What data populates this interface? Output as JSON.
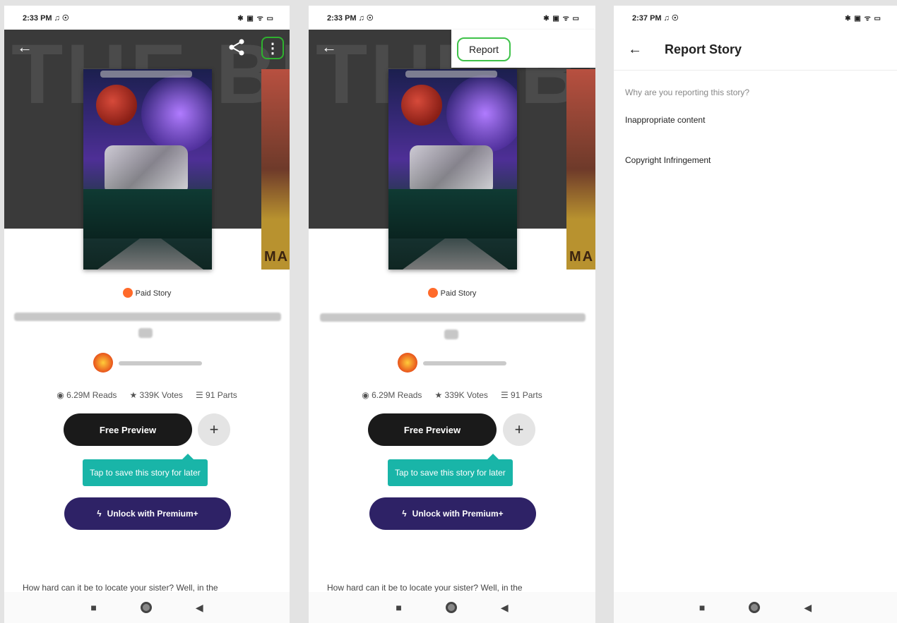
{
  "panel1": {
    "status": {
      "time": "2:33 PM ♫ ☉",
      "icons": "✱ ▣ ᯤ ▭"
    },
    "hero_text": "THE BR AH",
    "paid_label": "Paid Story",
    "stats": {
      "reads": "6.29M Reads",
      "votes": "339K Votes",
      "parts": "91 Parts"
    },
    "preview_label": "Free Preview",
    "plus_label": "+",
    "tooltip": "Tap to save this story for later",
    "premium_label": "Unlock with Premium+",
    "description": "How hard can it be to locate your sister? Well, in the",
    "side_cover_text": "MA"
  },
  "panel2": {
    "status": {
      "time": "2:33 PM ♫ ☉",
      "icons": "✱ ▣ ᯤ ▭"
    },
    "hero_text": "THE BR AH",
    "report_label": "Report",
    "paid_label": "Paid Story",
    "stats": {
      "reads": "6.29M Reads",
      "votes": "339K Votes",
      "parts": "91 Parts"
    },
    "preview_label": "Free Preview",
    "plus_label": "+",
    "tooltip": "Tap to save this story for later",
    "premium_label": "Unlock with Premium+",
    "description": "How hard can it be to locate your sister? Well, in the",
    "side_cover_text": "MA"
  },
  "panel3": {
    "status": {
      "time": "2:37 PM ♫ ☉",
      "icons": "✱ ▣ ᯤ ▭"
    },
    "title": "Report Story",
    "question": "Why are you reporting this story?",
    "options": [
      "Inappropriate content",
      "Copyright Infringement"
    ]
  },
  "icons": {
    "back": "←",
    "more": "⋮",
    "eye": "◉",
    "star": "★",
    "list": "☰",
    "bolt": "ϟ",
    "nav_square": "■",
    "nav_back": "◀"
  },
  "colors": {
    "teal": "#19b5a8",
    "premium": "#2e2266",
    "highlight": "#3fc24a",
    "coin": "#ff6a2a"
  }
}
